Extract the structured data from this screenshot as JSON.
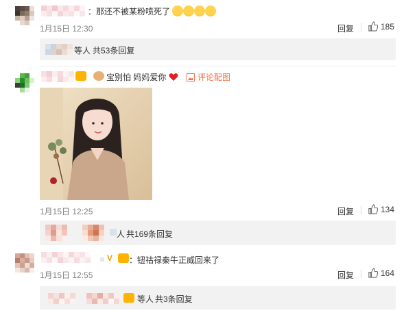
{
  "comment1": {
    "text": "：那还不被某粉喷死了",
    "time": "1月15日 12:30",
    "reply_label": "回复",
    "likes": "185",
    "sub": {
      "text": "等人",
      "link": "共53条回复"
    }
  },
  "comment2": {
    "handle_emoji_text": "宝别怕 妈妈爱你",
    "link_image": "评论配图",
    "time": "1月15日 12:25",
    "reply_label": "回复",
    "likes": "134",
    "sub": {
      "text": "人",
      "link": "共169条回复"
    }
  },
  "comment3": {
    "text": "：钮祜禄秦牛正威回来了",
    "time": "1月15日 12:55",
    "reply_label": "回复",
    "likes": "164",
    "sub": {
      "text": "等人",
      "link": "共3条回复"
    }
  },
  "icons": {
    "like": "thumb-up-icon",
    "comment_image": "image-icon",
    "emoji": "laugh-cry-emoji",
    "heart": "heart-icon"
  },
  "colors": {
    "accent_link": "#eb7350",
    "subbox_bg": "#f2f2f2",
    "muted": "#808080"
  }
}
